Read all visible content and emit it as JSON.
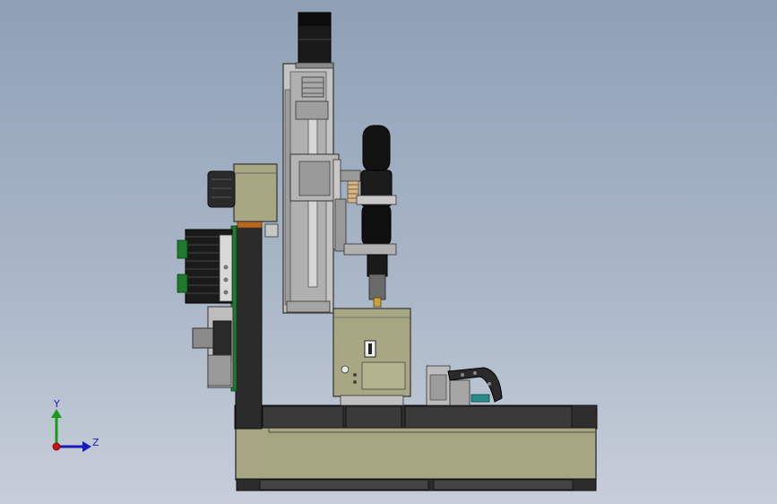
{
  "viewport": {
    "background_top": "#8fa0b6",
    "background_bottom": "#c7ced9"
  },
  "colors": {
    "housing": "#a4a47e",
    "housing_dark": "#7f805e",
    "frame": "#2b2b2b",
    "metal": "#c8c8c8",
    "metal_dark": "#8a8a8a",
    "tool_black": "#121212",
    "copper": "#b8681f",
    "green": "#1f7a2e",
    "teal": "#2a8a8a"
  },
  "triad": {
    "y_label": "Y",
    "z_label": "Z",
    "y_color": "#1a9a1a",
    "z_color": "#1a1ab8",
    "origin_color": "#d01010"
  }
}
